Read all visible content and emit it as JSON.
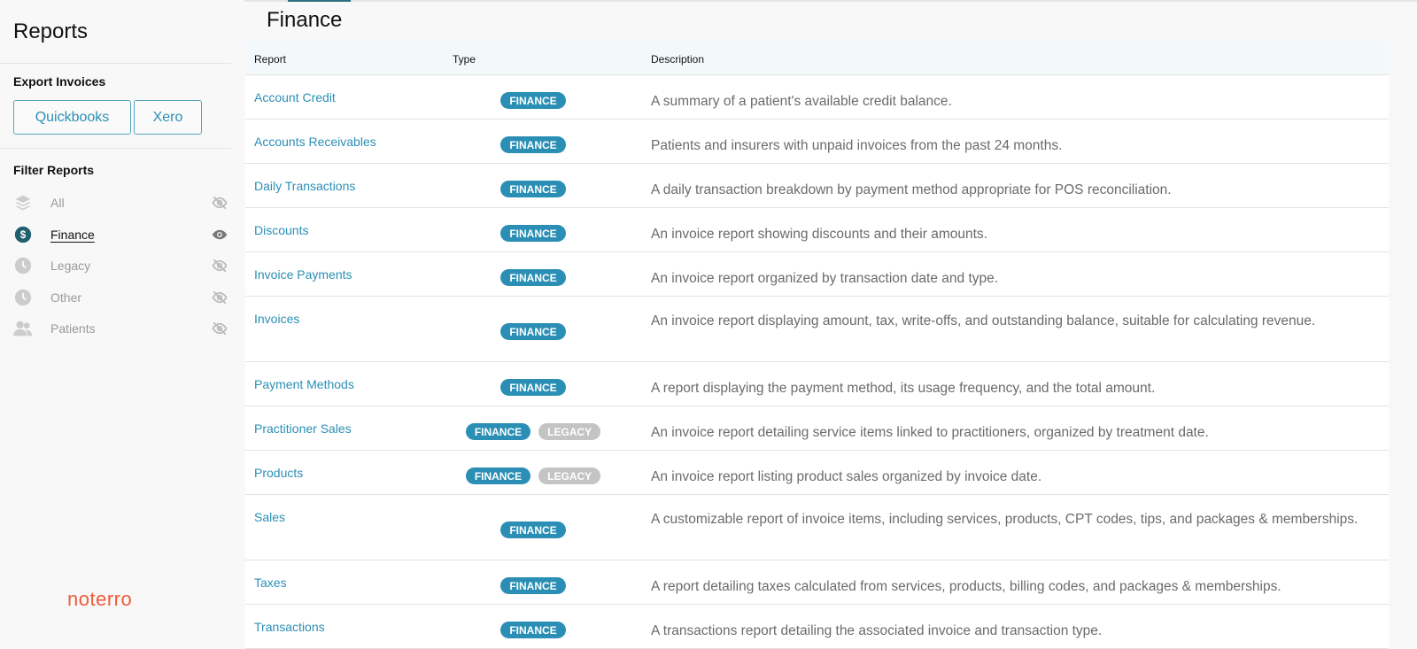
{
  "sidebar": {
    "title": "Reports",
    "export_heading": "Export Invoices",
    "export_buttons": [
      "Quickbooks",
      "Xero"
    ],
    "filter_heading": "Filter Reports",
    "filters": [
      {
        "label": "All",
        "icon": "layers-icon",
        "visible": false
      },
      {
        "label": "Finance",
        "icon": "dollar-icon",
        "visible": true,
        "active": true
      },
      {
        "label": "Legacy",
        "icon": "clock-icon",
        "visible": false
      },
      {
        "label": "Other",
        "icon": "clock-icon",
        "visible": false
      },
      {
        "label": "Patients",
        "icon": "users-icon",
        "visible": false
      }
    ],
    "logo": "noterro"
  },
  "main": {
    "title": "Finance",
    "columns": [
      "Report",
      "Type",
      "Description"
    ],
    "rows": [
      {
        "name": "Account Credit",
        "types": [
          "FINANCE"
        ],
        "description": "A summary of a patient's available credit balance."
      },
      {
        "name": "Accounts Receivables",
        "types": [
          "FINANCE"
        ],
        "description": "Patients and insurers with unpaid invoices from the past 24 months."
      },
      {
        "name": "Daily Transactions",
        "types": [
          "FINANCE"
        ],
        "description": "A daily transaction breakdown by payment method appropriate for POS reconciliation."
      },
      {
        "name": "Discounts",
        "types": [
          "FINANCE"
        ],
        "description": "An invoice report showing discounts and their amounts."
      },
      {
        "name": "Invoice Payments",
        "types": [
          "FINANCE"
        ],
        "description": "An invoice report organized by transaction date and type."
      },
      {
        "name": "Invoices",
        "types": [
          "FINANCE"
        ],
        "description": "An invoice report displaying amount, tax, write-offs, and outstanding balance, suitable for calculating revenue."
      },
      {
        "name": "Payment Methods",
        "types": [
          "FINANCE"
        ],
        "description": "A report displaying the payment method, its usage frequency, and the total amount."
      },
      {
        "name": "Practitioner Sales",
        "types": [
          "FINANCE",
          "LEGACY"
        ],
        "description": "An invoice report detailing service items linked to practitioners, organized by treatment date."
      },
      {
        "name": "Products",
        "types": [
          "FINANCE",
          "LEGACY"
        ],
        "description": "An invoice report listing product sales organized by invoice date."
      },
      {
        "name": "Sales",
        "types": [
          "FINANCE"
        ],
        "description": "A customizable report of invoice items, including services, products, CPT codes, tips, and packages & memberships."
      },
      {
        "name": "Taxes",
        "types": [
          "FINANCE"
        ],
        "description": "A report detailing taxes calculated from services, products, billing codes, and packages & memberships."
      },
      {
        "name": "Transactions",
        "types": [
          "FINANCE"
        ],
        "description": "A transactions report detailing the associated invoice and transaction type."
      }
    ]
  },
  "colors": {
    "accent": "#2b8fb5",
    "finance_badge": "#2b8fb5",
    "legacy_badge": "#c4c4c4",
    "logo": "#f05a3a",
    "active_icon": "#1f5f6e"
  }
}
